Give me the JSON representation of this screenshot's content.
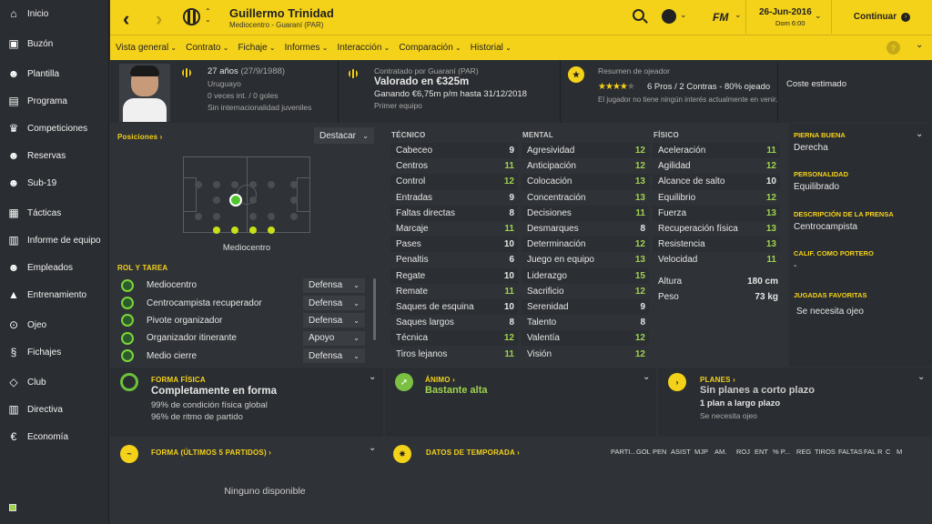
{
  "sidebar": {
    "items": [
      {
        "label": "Inicio",
        "icon": "home-icon"
      },
      {
        "label": "Buzón",
        "icon": "inbox-icon"
      },
      {
        "label": "Plantilla",
        "icon": "squad-icon"
      },
      {
        "label": "Programa",
        "icon": "calendar-icon"
      },
      {
        "label": "Competiciones",
        "icon": "trophy-icon"
      },
      {
        "label": "Reservas",
        "icon": "reserves-icon"
      },
      {
        "label": "Sub-19",
        "icon": "u19-icon"
      },
      {
        "label": "Tácticas",
        "icon": "tactics-icon"
      },
      {
        "label": "Informe de equipo",
        "icon": "report-icon"
      },
      {
        "label": "Empleados",
        "icon": "staff-icon"
      },
      {
        "label": "Entrenamiento",
        "icon": "training-icon"
      },
      {
        "label": "Ojeo",
        "icon": "scouting-icon"
      },
      {
        "label": "Fichajes",
        "icon": "transfers-icon"
      },
      {
        "label": "Club",
        "icon": "club-icon"
      },
      {
        "label": "Directiva",
        "icon": "board-icon"
      },
      {
        "label": "Economía",
        "icon": "finance-icon"
      }
    ]
  },
  "header": {
    "player_name": "Guillermo Trinidad",
    "player_sub": "Mediocentro - Guaraní (PAR)",
    "logo_text": "FM",
    "date": "26-Jun-2016",
    "time": "Dom 6:00",
    "continue_label": "Continuar",
    "tabs": [
      "Vista general",
      "Contrato",
      "Fichaje",
      "Informes",
      "Interacción",
      "Comparación",
      "Historial"
    ],
    "help": "?"
  },
  "profile": {
    "age": "27 años",
    "dob": "(27/9/1988)",
    "nationality": "Uruguayo",
    "caps": "0 veces int. / 0 goles",
    "youth": "Sin internacionalidad juveniles",
    "contract_by": "Contratado por Guaraní (PAR)",
    "value": "Valorado en €325m",
    "wage": "Ganando €6,75m p/m hasta 31/12/2018",
    "team": "Primer equipo",
    "scout_title": "Resumen de ojeador",
    "scout_rating": 4,
    "scout_summary": "6 Pros / 2 Contras - 80% ojeado",
    "scout_note": "El jugador no tiene ningún interés actualmente en venir.",
    "cost_label": "Coste estimado"
  },
  "positions": {
    "title": "Posiciones ›",
    "select": "Destacar",
    "label": "Mediocentro"
  },
  "roles": {
    "title": "ROL Y TAREA",
    "items": [
      {
        "name": "Mediocentro",
        "duty": "Defensa"
      },
      {
        "name": "Centrocampista recuperador",
        "duty": "Defensa"
      },
      {
        "name": "Pivote organizador",
        "duty": "Defensa"
      },
      {
        "name": "Organizador itinerante",
        "duty": "Apoyo"
      },
      {
        "name": "Medio cierre",
        "duty": "Defensa"
      }
    ]
  },
  "attributes": {
    "tecnico_title": "TÉCNICO",
    "mental_title": "MENTAL",
    "fisico_title": "FÍSICO",
    "tecnico": [
      {
        "n": "Cabeceo",
        "v": "9"
      },
      {
        "n": "Centros",
        "v": "11"
      },
      {
        "n": "Control",
        "v": "12"
      },
      {
        "n": "Entradas",
        "v": "9"
      },
      {
        "n": "Faltas directas",
        "v": "8"
      },
      {
        "n": "Marcaje",
        "v": "11"
      },
      {
        "n": "Pases",
        "v": "10"
      },
      {
        "n": "Penaltis",
        "v": "6"
      },
      {
        "n": "Regate",
        "v": "10"
      },
      {
        "n": "Remate",
        "v": "11"
      },
      {
        "n": "Saques de esquina",
        "v": "10"
      },
      {
        "n": "Saques largos",
        "v": "8"
      },
      {
        "n": "Técnica",
        "v": "12"
      },
      {
        "n": "Tiros lejanos",
        "v": "11"
      }
    ],
    "mental": [
      {
        "n": "Agresividad",
        "v": "12"
      },
      {
        "n": "Anticipación",
        "v": "12"
      },
      {
        "n": "Colocación",
        "v": "13"
      },
      {
        "n": "Concentración",
        "v": "13"
      },
      {
        "n": "Decisiones",
        "v": "11"
      },
      {
        "n": "Desmarques",
        "v": "8"
      },
      {
        "n": "Determinación",
        "v": "12"
      },
      {
        "n": "Juego en equipo",
        "v": "13"
      },
      {
        "n": "Liderazgo",
        "v": "15"
      },
      {
        "n": "Sacrificio",
        "v": "12"
      },
      {
        "n": "Serenidad",
        "v": "9"
      },
      {
        "n": "Talento",
        "v": "8"
      },
      {
        "n": "Valentía",
        "v": "12"
      },
      {
        "n": "Visión",
        "v": "12"
      }
    ],
    "fisico": [
      {
        "n": "Aceleración",
        "v": "11"
      },
      {
        "n": "Agilidad",
        "v": "12"
      },
      {
        "n": "Alcance de salto",
        "v": "10"
      },
      {
        "n": "Equilibrio",
        "v": "12"
      },
      {
        "n": "Fuerza",
        "v": "13"
      },
      {
        "n": "Recuperación física",
        "v": "13"
      },
      {
        "n": "Resistencia",
        "v": "13"
      },
      {
        "n": "Velocidad",
        "v": "11"
      }
    ],
    "height_label": "Altura",
    "height": "180 cm",
    "weight_label": "Peso",
    "weight": "73 kg"
  },
  "side": {
    "foot_h": "PIERNA BUENA",
    "foot_v": "Derecha",
    "pers_h": "PERSONALIDAD",
    "pers_v": "Equilibrado",
    "press_h": "DESCRIPCIÓN DE LA PRENSA",
    "press_v": "Centrocampista",
    "gk_h": "CALIF. COMO PORTERO",
    "gk_v": "-",
    "plays_h": "JUGADAS FAVORITAS",
    "plays_v": "Se necesita ojeo"
  },
  "condition": {
    "title": "FORMA FÍSICA",
    "main": "Completamente en forma",
    "l1": "99% de condición física global",
    "l2": "96% de ritmo de partido"
  },
  "morale": {
    "title": "ÁNIMO ›",
    "value": "Bastante alta"
  },
  "plans": {
    "title": "PLANES ›",
    "short": "Sin planes a corto plazo",
    "long": "1 plan a largo plazo",
    "note": "Se necesita ojeo"
  },
  "form": {
    "title": "FORMA (ÚLTIMOS 5 PARTIDOS) ›",
    "empty": "Ninguno disponible"
  },
  "season": {
    "title": "DATOS DE TEMPORADA ›",
    "cols": [
      "PARTI...",
      "GOL",
      "PEN",
      "ASIST",
      "MJP",
      "AM.",
      "ROJ",
      "ENT",
      "% P...",
      "REG",
      "TIROS",
      "FALTAS",
      "FAL R",
      "C",
      "M"
    ]
  },
  "colors": {
    "accent": "#f5d21a",
    "green": "#9fd34f",
    "bg": "#2f3236"
  }
}
